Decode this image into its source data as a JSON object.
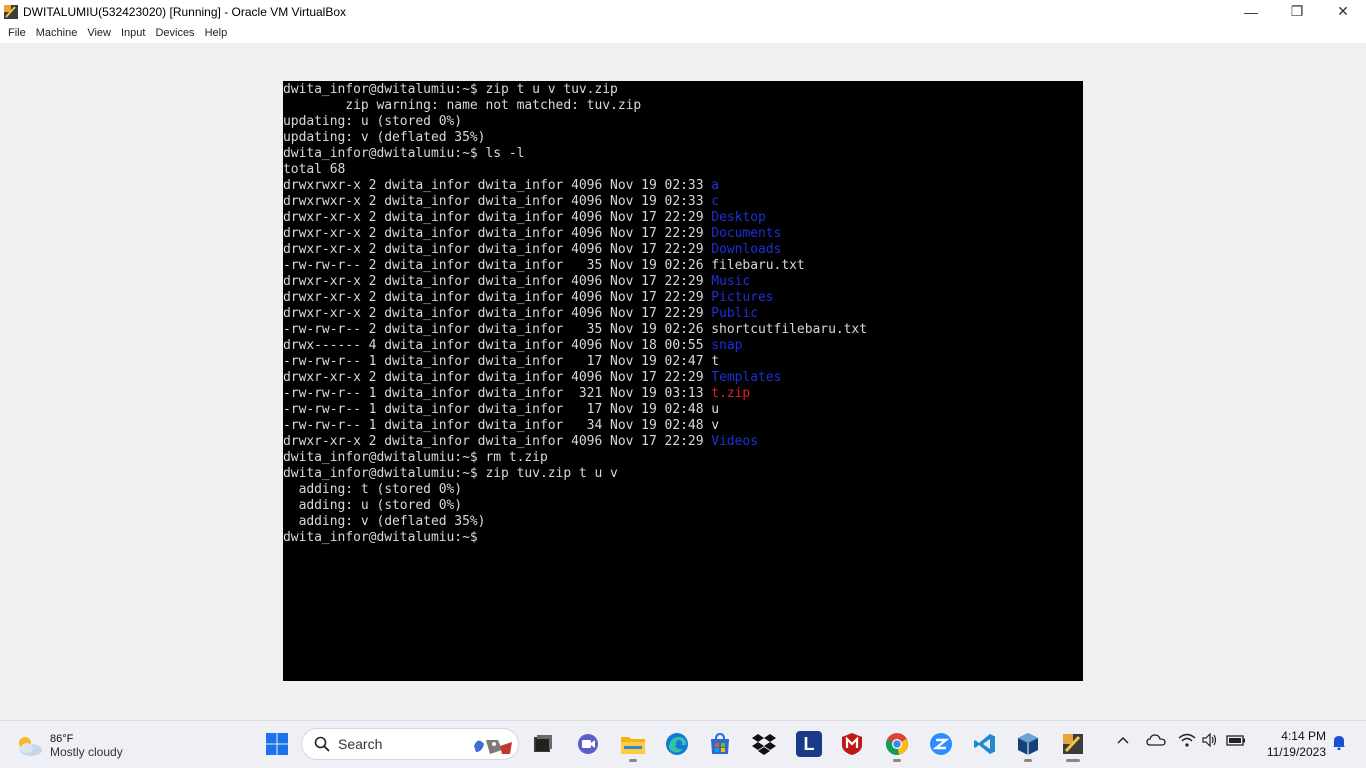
{
  "window": {
    "title": "DWITALUMIU(532423020) [Running] - Oracle VM VirtualBox",
    "minimize": "—",
    "restore": "❐",
    "close": "✕"
  },
  "menubar": {
    "items": [
      {
        "label": "File"
      },
      {
        "label": "Machine"
      },
      {
        "label": "View"
      },
      {
        "label": "Input"
      },
      {
        "label": "Devices"
      },
      {
        "label": "Help"
      }
    ]
  },
  "terminal": {
    "lines": [
      [
        {
          "t": "dwita_infor@dwitalumiu:~$ zip t u v tuv.zip",
          "c": ""
        }
      ],
      [
        {
          "t": "        zip warning: name not matched: tuv.zip",
          "c": ""
        }
      ],
      [
        {
          "t": "updating: u (stored 0%)",
          "c": ""
        }
      ],
      [
        {
          "t": "updating: v (deflated 35%)",
          "c": ""
        }
      ],
      [
        {
          "t": "dwita_infor@dwitalumiu:~$ ls -l",
          "c": ""
        }
      ],
      [
        {
          "t": "total 68",
          "c": ""
        }
      ],
      [
        {
          "t": "drwxrwxr-x 2 dwita_infor dwita_infor 4096 Nov 19 02:33 ",
          "c": ""
        },
        {
          "t": "a",
          "c": "blue"
        }
      ],
      [
        {
          "t": "drwxrwxr-x 2 dwita_infor dwita_infor 4096 Nov 19 02:33 ",
          "c": ""
        },
        {
          "t": "c",
          "c": "blue"
        }
      ],
      [
        {
          "t": "drwxr-xr-x 2 dwita_infor dwita_infor 4096 Nov 17 22:29 ",
          "c": ""
        },
        {
          "t": "Desktop",
          "c": "blue"
        }
      ],
      [
        {
          "t": "drwxr-xr-x 2 dwita_infor dwita_infor 4096 Nov 17 22:29 ",
          "c": ""
        },
        {
          "t": "Documents",
          "c": "blue"
        }
      ],
      [
        {
          "t": "drwxr-xr-x 2 dwita_infor dwita_infor 4096 Nov 17 22:29 ",
          "c": ""
        },
        {
          "t": "Downloads",
          "c": "blue"
        }
      ],
      [
        {
          "t": "-rw-rw-r-- 2 dwita_infor dwita_infor   35 Nov 19 02:26 filebaru.txt",
          "c": ""
        }
      ],
      [
        {
          "t": "drwxr-xr-x 2 dwita_infor dwita_infor 4096 Nov 17 22:29 ",
          "c": ""
        },
        {
          "t": "Music",
          "c": "blue"
        }
      ],
      [
        {
          "t": "drwxr-xr-x 2 dwita_infor dwita_infor 4096 Nov 17 22:29 ",
          "c": ""
        },
        {
          "t": "Pictures",
          "c": "blue"
        }
      ],
      [
        {
          "t": "drwxr-xr-x 2 dwita_infor dwita_infor 4096 Nov 17 22:29 ",
          "c": ""
        },
        {
          "t": "Public",
          "c": "blue"
        }
      ],
      [
        {
          "t": "-rw-rw-r-- 2 dwita_infor dwita_infor   35 Nov 19 02:26 shortcutfilebaru.txt",
          "c": ""
        }
      ],
      [
        {
          "t": "drwx------ 4 dwita_infor dwita_infor 4096 Nov 18 00:55 ",
          "c": ""
        },
        {
          "t": "snap",
          "c": "blue"
        }
      ],
      [
        {
          "t": "-rw-rw-r-- 1 dwita_infor dwita_infor   17 Nov 19 02:47 t",
          "c": ""
        }
      ],
      [
        {
          "t": "drwxr-xr-x 2 dwita_infor dwita_infor 4096 Nov 17 22:29 ",
          "c": ""
        },
        {
          "t": "Templates",
          "c": "blue"
        }
      ],
      [
        {
          "t": "-rw-rw-r-- 1 dwita_infor dwita_infor  321 Nov 19 03:13 ",
          "c": ""
        },
        {
          "t": "t.zip",
          "c": "red"
        }
      ],
      [
        {
          "t": "-rw-rw-r-- 1 dwita_infor dwita_infor   17 Nov 19 02:48 u",
          "c": ""
        }
      ],
      [
        {
          "t": "-rw-rw-r-- 1 dwita_infor dwita_infor   34 Nov 19 02:48 v",
          "c": ""
        }
      ],
      [
        {
          "t": "drwxr-xr-x 2 dwita_infor dwita_infor 4096 Nov 17 22:29 ",
          "c": ""
        },
        {
          "t": "Videos",
          "c": "blue"
        }
      ],
      [
        {
          "t": "dwita_infor@dwitalumiu:~$ rm t.zip",
          "c": ""
        }
      ],
      [
        {
          "t": "dwita_infor@dwitalumiu:~$ zip tuv.zip t u v",
          "c": ""
        }
      ],
      [
        {
          "t": "  adding: t (stored 0%)",
          "c": ""
        }
      ],
      [
        {
          "t": "  adding: u (stored 0%)",
          "c": ""
        }
      ],
      [
        {
          "t": "  adding: v (deflated 35%)",
          "c": ""
        }
      ],
      [
        {
          "t": "dwita_infor@dwitalumiu:~$",
          "c": ""
        }
      ]
    ]
  },
  "taskbar": {
    "weather": {
      "temp": "86°F",
      "desc": "Mostly cloudy"
    },
    "search_placeholder": "Search",
    "apps": [
      {
        "name": "start-icon",
        "glyph": ""
      },
      {
        "name": "task-view-icon",
        "glyph": ""
      },
      {
        "name": "meet-icon",
        "glyph": ""
      },
      {
        "name": "file-explorer-icon",
        "glyph": ""
      },
      {
        "name": "edge-icon",
        "glyph": ""
      },
      {
        "name": "store-icon",
        "glyph": ""
      },
      {
        "name": "dropbox-icon",
        "glyph": ""
      },
      {
        "name": "l-app-icon",
        "glyph": "L"
      },
      {
        "name": "mcafee-icon",
        "glyph": ""
      },
      {
        "name": "chrome-icon",
        "glyph": ""
      },
      {
        "name": "zoom-icon",
        "glyph": ""
      },
      {
        "name": "vscode-icon",
        "glyph": ""
      },
      {
        "name": "virtualbox-icon",
        "glyph": ""
      },
      {
        "name": "virtualbox-vm-icon",
        "glyph": ""
      }
    ],
    "clock": {
      "time": "4:14 PM",
      "date": "11/19/2023"
    }
  }
}
